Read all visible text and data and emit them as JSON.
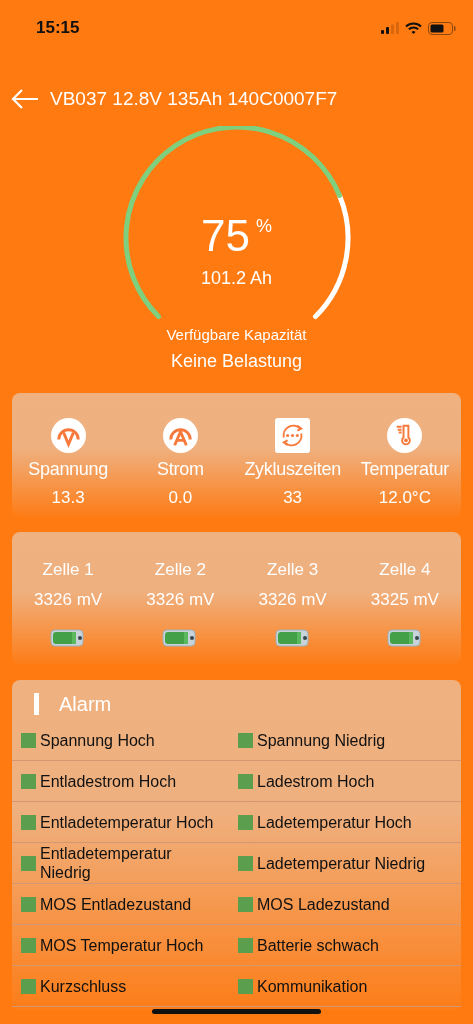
{
  "status_bar": {
    "time": "15:15"
  },
  "header": {
    "title": "VB037 12.8V 135Ah 140C0007F7"
  },
  "gauge": {
    "value": "75",
    "unit": "%",
    "capacity": "101.2 Ah",
    "label": "Verfügbare Kapazität"
  },
  "load_status": "Keine Belastung",
  "metrics": [
    {
      "kind": "voltage",
      "label": "Spannung",
      "value": "13.3"
    },
    {
      "kind": "current",
      "label": "Strom",
      "value": "0.0"
    },
    {
      "kind": "cycles",
      "label": "Zykluszeiten",
      "value": "33"
    },
    {
      "kind": "temperature",
      "label": "Temperatur",
      "value": "12.0°C"
    }
  ],
  "cells": [
    {
      "label": "Zelle 1",
      "voltage": "3326 mV"
    },
    {
      "label": "Zelle 2",
      "voltage": "3326 mV"
    },
    {
      "label": "Zelle 3",
      "voltage": "3326 mV"
    },
    {
      "label": "Zelle 4",
      "voltage": "3325 mV"
    }
  ],
  "alarm": {
    "title": "Alarm",
    "items": [
      {
        "label": "Spannung Hoch",
        "color": "#5a9e4e"
      },
      {
        "label": "Spannung Niedrig",
        "color": "#5a9e4e"
      },
      {
        "label": "Entladestrom Hoch",
        "color": "#5a9e4e"
      },
      {
        "label": "Ladestrom Hoch",
        "color": "#5a9e4e"
      },
      {
        "label": "Entladetemperatur Hoch",
        "color": "#5a9e4e"
      },
      {
        "label": "Ladetemperatur Hoch",
        "color": "#5a9e4e"
      },
      {
        "label": "Entladetemperatur Niedrig",
        "color": "#5a9e4e"
      },
      {
        "label": "Ladetemperatur Niedrig",
        "color": "#5a9e4e"
      },
      {
        "label": "MOS Entladezustand",
        "color": "#5a9e4e"
      },
      {
        "label": "MOS Ladezustand",
        "color": "#5a9e4e"
      },
      {
        "label": "MOS Temperatur Hoch",
        "color": "#5a9e4e"
      },
      {
        "label": "Batterie schwach",
        "color": "#5a9e4e"
      },
      {
        "label": "Kurzschluss",
        "color": "#5a9e4e"
      },
      {
        "label": "Kommunikation",
        "color": "#5a9e4e"
      }
    ]
  }
}
